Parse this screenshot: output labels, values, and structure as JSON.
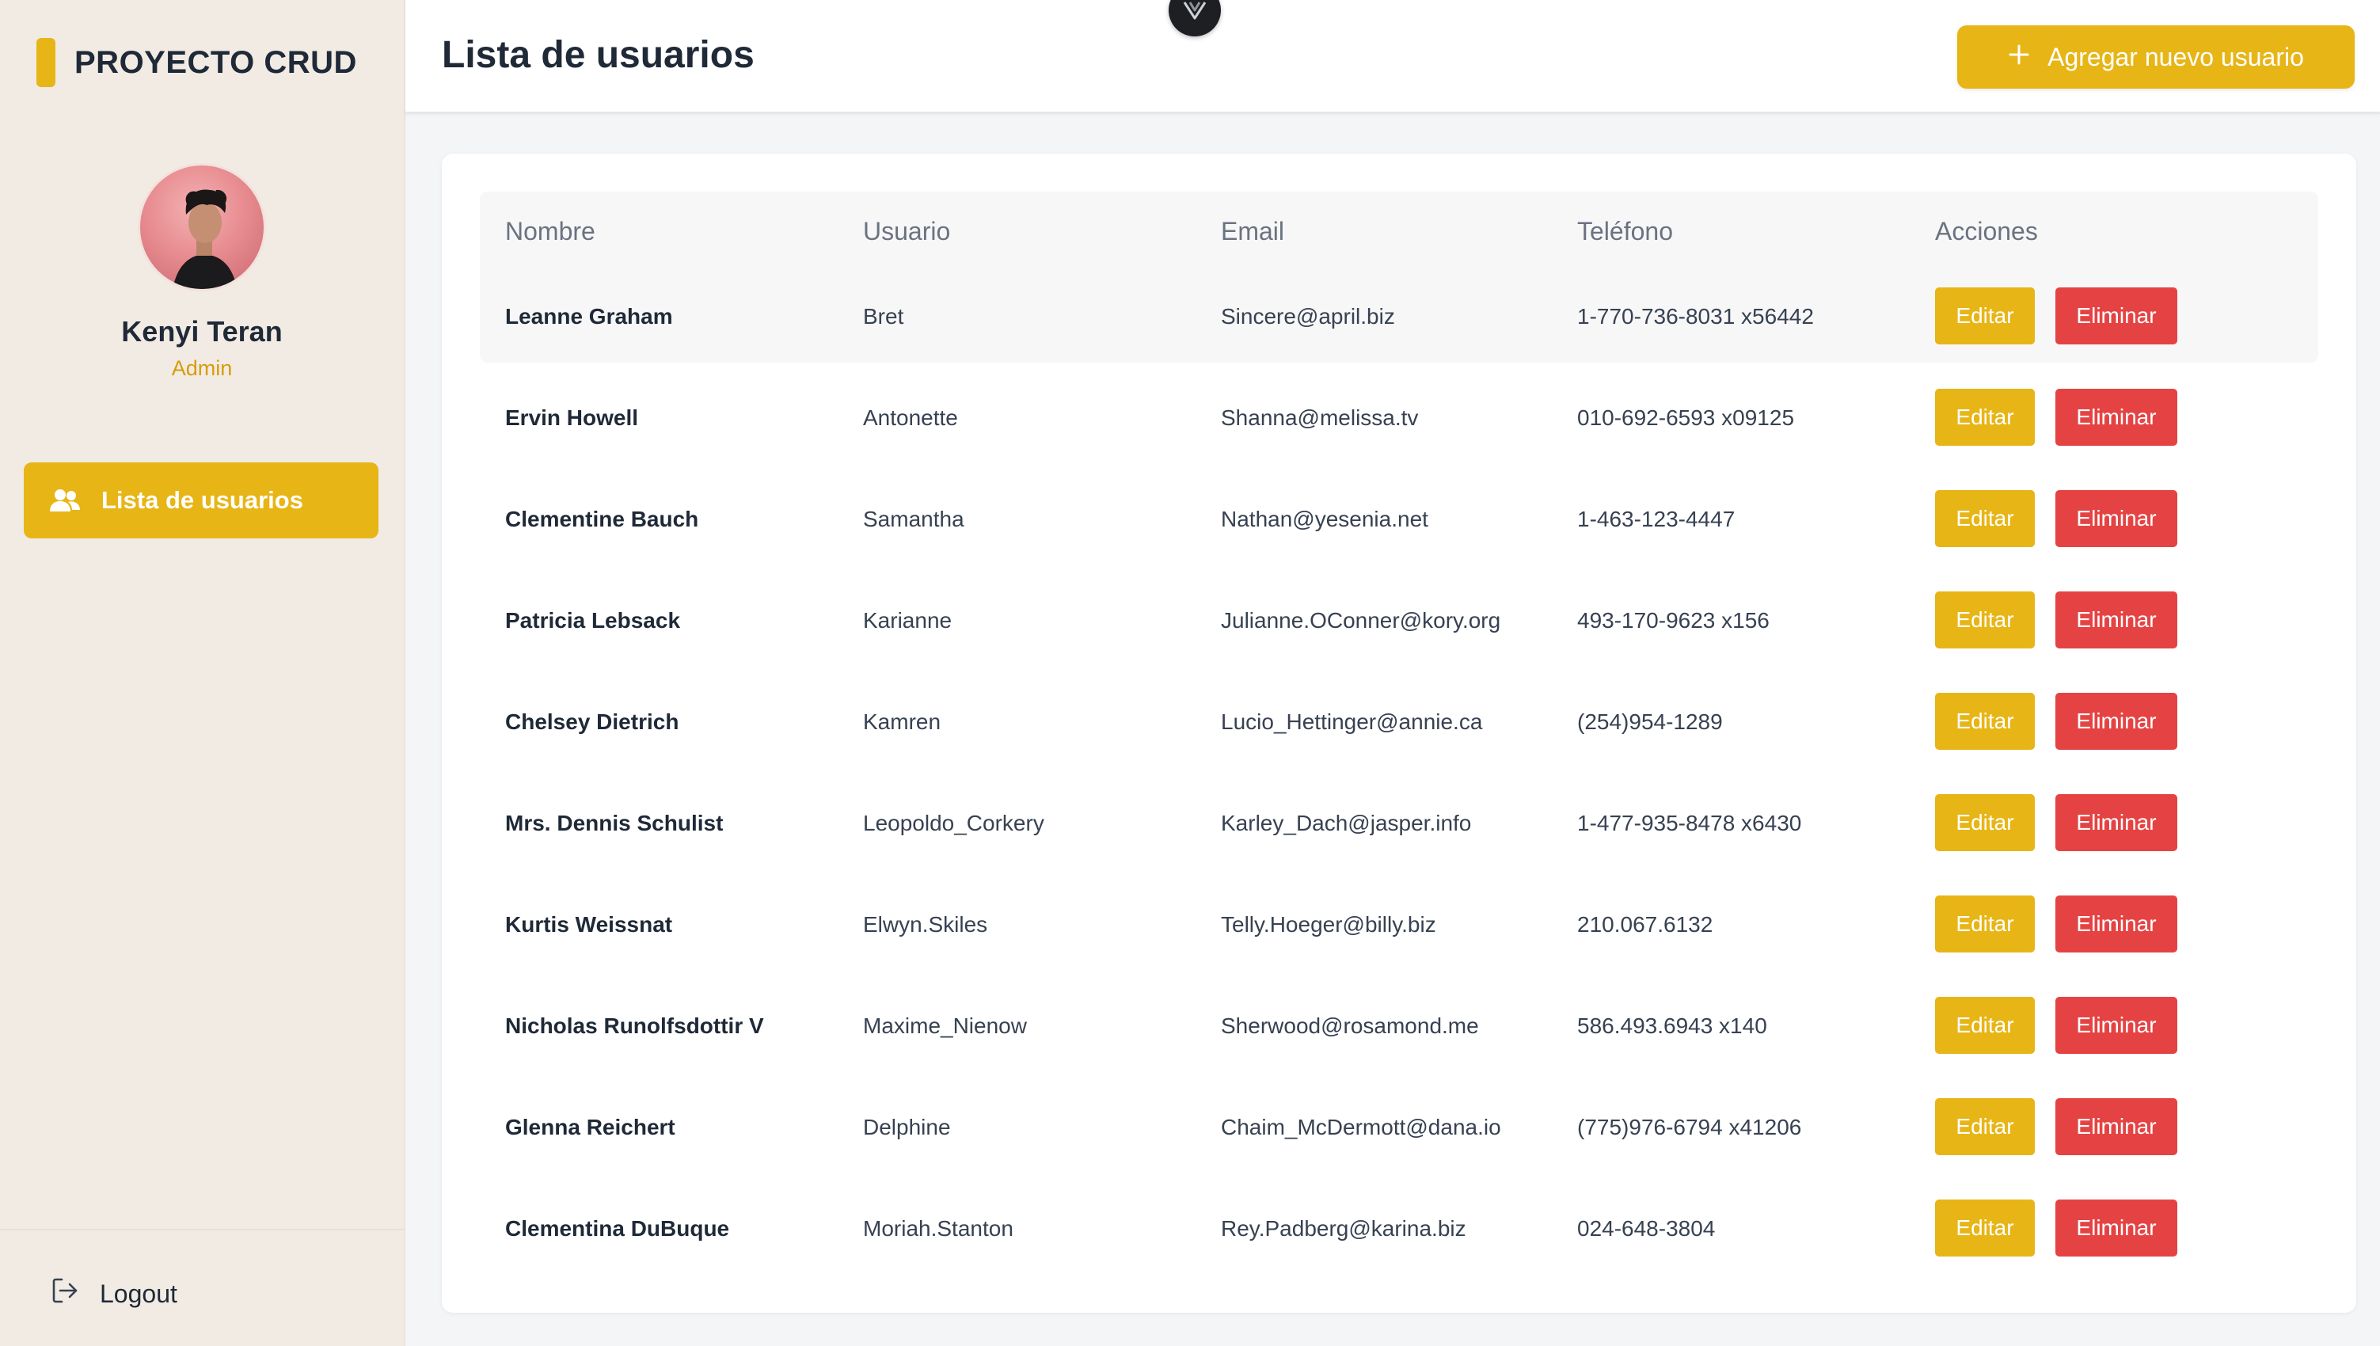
{
  "sidebar": {
    "brand": "PROYECTO CRUD",
    "profile": {
      "name": "Kenyi Teran",
      "role": "Admin"
    },
    "nav_items": [
      {
        "label": "Lista de usuarios",
        "icon": "users-icon"
      }
    ],
    "logout_label": "Logout"
  },
  "header": {
    "title": "Lista de usuarios",
    "add_button_label": "Agregar nuevo usuario",
    "badge_letter": "V"
  },
  "table": {
    "columns": [
      "Nombre",
      "Usuario",
      "Email",
      "Teléfono",
      "Acciones"
    ],
    "edit_label": "Editar",
    "delete_label": "Eliminar",
    "rows": [
      {
        "name": "Leanne Graham",
        "username": "Bret",
        "email": "Sincere@april.biz",
        "phone": "1-770-736-8031 x56442"
      },
      {
        "name": "Ervin Howell",
        "username": "Antonette",
        "email": "Shanna@melissa.tv",
        "phone": "010-692-6593 x09125"
      },
      {
        "name": "Clementine Bauch",
        "username": "Samantha",
        "email": "Nathan@yesenia.net",
        "phone": "1-463-123-4447"
      },
      {
        "name": "Patricia Lebsack",
        "username": "Karianne",
        "email": "Julianne.OConner@kory.org",
        "phone": "493-170-9623 x156"
      },
      {
        "name": "Chelsey Dietrich",
        "username": "Kamren",
        "email": "Lucio_Hettinger@annie.ca",
        "phone": "(254)954-1289"
      },
      {
        "name": "Mrs. Dennis Schulist",
        "username": "Leopoldo_Corkery",
        "email": "Karley_Dach@jasper.info",
        "phone": "1-477-935-8478 x6430"
      },
      {
        "name": "Kurtis Weissnat",
        "username": "Elwyn.Skiles",
        "email": "Telly.Hoeger@billy.biz",
        "phone": "210.067.6132"
      },
      {
        "name": "Nicholas Runolfsdottir V",
        "username": "Maxime_Nienow",
        "email": "Sherwood@rosamond.me",
        "phone": "586.493.6943 x140"
      },
      {
        "name": "Glenna Reichert",
        "username": "Delphine",
        "email": "Chaim_McDermott@dana.io",
        "phone": "(775)976-6794 x41206"
      },
      {
        "name": "Clementina DuBuque",
        "username": "Moriah.Stanton",
        "email": "Rey.Padberg@karina.biz",
        "phone": "024-648-3804"
      }
    ]
  },
  "colors": {
    "accent": "#e7b516",
    "danger": "#e54343",
    "sidebar_bg": "#f1ebe4",
    "role_text": "#d79c0a"
  }
}
